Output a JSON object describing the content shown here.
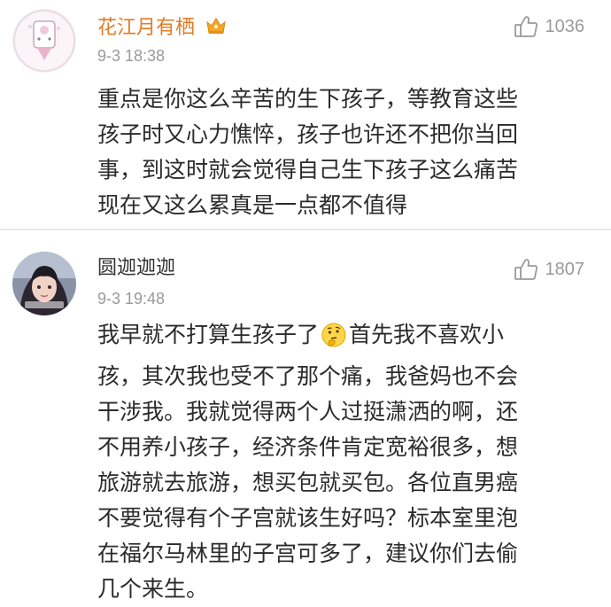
{
  "comments": [
    {
      "username": "花江月有栖",
      "username_color": "#e37b24",
      "has_vip_badge": true,
      "time": "9-3 18:38",
      "likes": "1036",
      "lines": [
        "重点是你这么辛苦的生下孩子，等教育这些",
        "孩子时又心力憔悴，孩子也许还不把你当回",
        "事，到这时就会觉得自己生下孩子这么痛苦",
        "现在又这么累真是一点都不值得"
      ]
    },
    {
      "username": "圆迦迦迦",
      "username_color": "#333333",
      "time": "9-3 19:48",
      "likes": "1807",
      "first_line_before_emoji": "我早就不打算生孩子了",
      "first_line_after_emoji": "首先我不喜欢小",
      "emoji": "thinking-face",
      "lines": [
        "孩，其次我也受不了那个痛，我爸妈也不会",
        "干涉我。我就觉得两个人过挺潇洒的啊，还",
        "不用养小孩子，经济条件肯定宽裕很多，想",
        "旅游就去旅游，想买包就买包。各位直男癌",
        "不要觉得有个子宫就该生好吗？标本室里泡",
        "在福尔马林里的子宫可多了，建议你们去偷",
        "几个来生。"
      ]
    }
  ],
  "icons": {
    "like": "thumbs-up-icon",
    "badge": "vip-crown-icon"
  }
}
